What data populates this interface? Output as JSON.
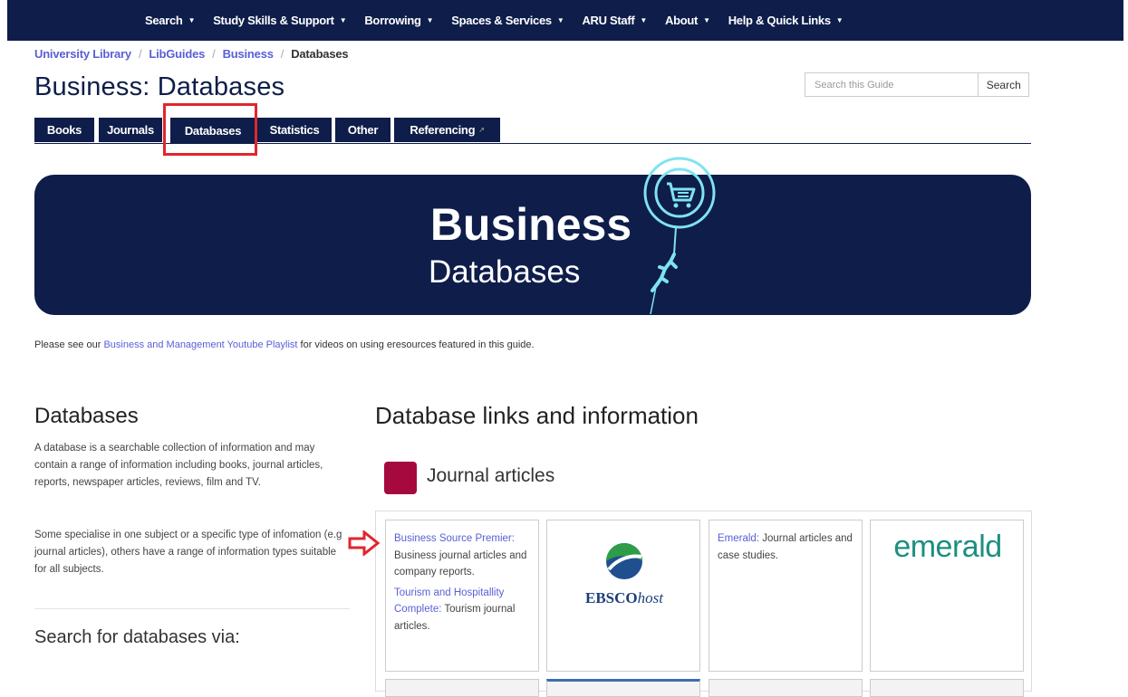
{
  "nav": {
    "items": [
      {
        "label": "Search",
        "caret": "▼"
      },
      {
        "label": "Study Skills & Support",
        "caret": "▼"
      },
      {
        "label": "Borrowing",
        "caret": "▼"
      },
      {
        "label": "Spaces & Services",
        "caret": "▼"
      },
      {
        "label": "ARU Staff",
        "caret": "▼"
      },
      {
        "label": "About",
        "caret": "▼"
      },
      {
        "label": "Help & Quick Links",
        "caret": "▼"
      }
    ]
  },
  "breadcrumb": {
    "items": [
      "University Library",
      "LibGuides",
      "Business"
    ],
    "current": "Databases",
    "separator": "/"
  },
  "page": {
    "title": "Business: Databases"
  },
  "search": {
    "placeholder": "Search this Guide",
    "button": "Search"
  },
  "tabs": {
    "items": [
      {
        "label": "Books"
      },
      {
        "label": "Journals"
      },
      {
        "label": "Databases",
        "active": true
      },
      {
        "label": "Statistics"
      },
      {
        "label": "Other"
      },
      {
        "label": "Referencing",
        "external": true
      }
    ],
    "external_icon": "↗"
  },
  "banner": {
    "title": "Business",
    "subtitle": "Databases"
  },
  "intro": {
    "before": "Please see our ",
    "link": "Business and Management Youtube Playlist",
    "after": " for videos on using eresources featured in this guide."
  },
  "left": {
    "heading": "Databases",
    "para1": "A database is a searchable collection of information and may contain a range of information including books, journal articles, reports, newspaper articles, reviews, film and TV.",
    "para2": "Some specialise in one subject or a specific type of infomation (e.g journal articles), others have a range of information types suitable for all subjects.",
    "heading2": "Search for databases via:"
  },
  "right": {
    "heading": "Database links and information",
    "section_title": "Journal articles",
    "section_color": "#a6093d",
    "card1": {
      "entry1_link": "Business Source Premier:",
      "entry1_text": " Business journal articles and company reports.",
      "entry2_link": "Tourism and Hospitallity Complete:",
      "entry2_text": " Tourism journal articles."
    },
    "card2": {
      "logo_bold": "EBSCO",
      "logo_italic": "host"
    },
    "card3": {
      "link": "Emerald:",
      "text": " Journal articles and case studies."
    },
    "card4": {
      "logo": "emerald"
    }
  },
  "colors": {
    "navy": "#0e1d4a",
    "link": "#5a5fd6",
    "highlight": "#e0262d",
    "emerald": "#1c8f80"
  }
}
